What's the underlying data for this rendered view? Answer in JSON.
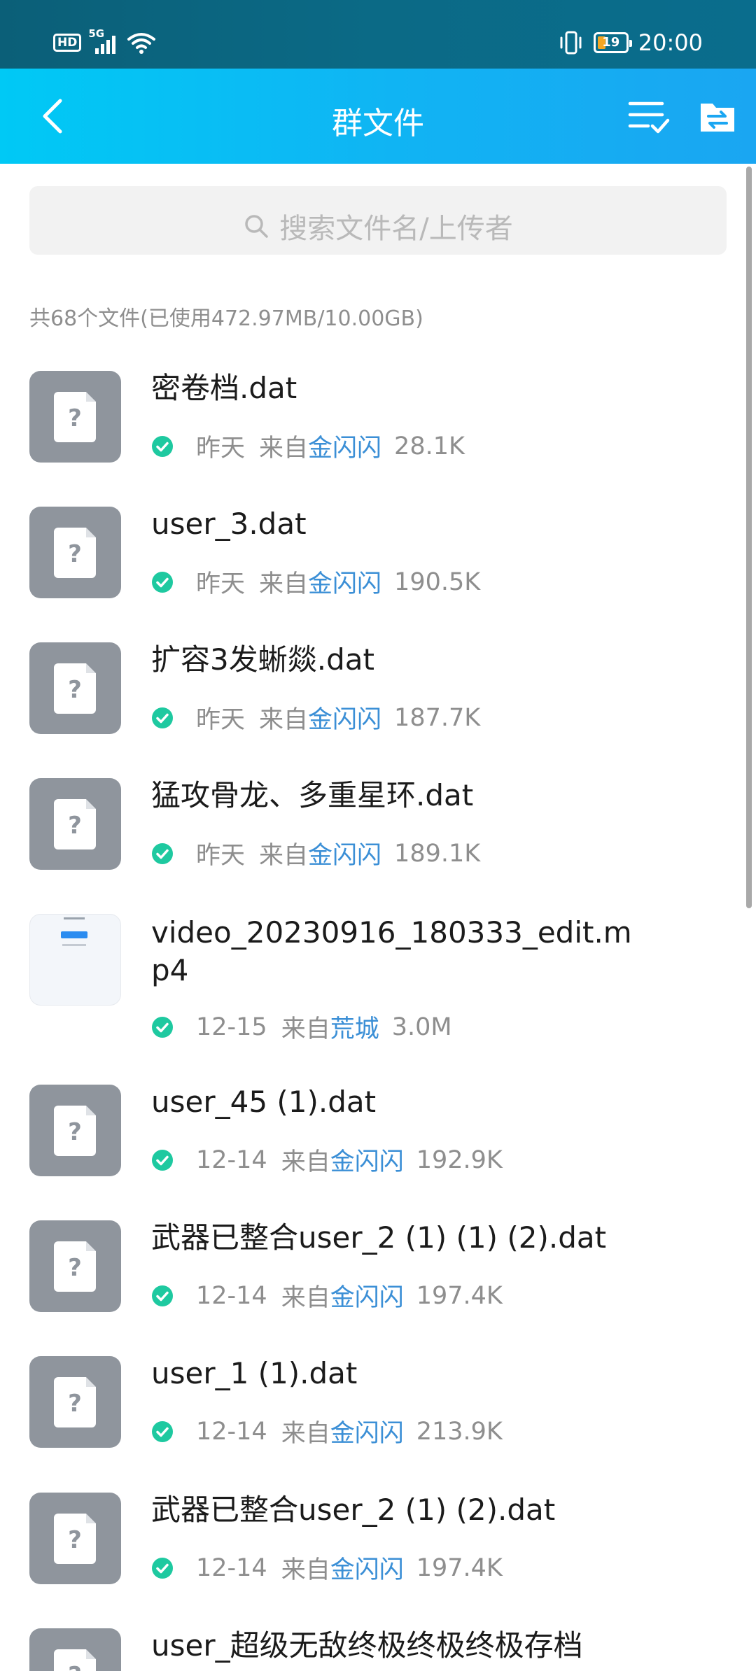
{
  "status_bar": {
    "hd": "HD",
    "network": "5G",
    "battery": "19",
    "time": "20:00"
  },
  "app_bar": {
    "title": "群文件"
  },
  "search": {
    "placeholder": "搜索文件名/上传者"
  },
  "summary": "共68个文件(已使用472.97MB/10.00GB)",
  "from_label": "来自",
  "files": [
    {
      "name": "密卷档.dat",
      "date": "昨天",
      "uploader": "金闪闪",
      "size": "28.1K",
      "type": "unknown"
    },
    {
      "name": "user_3.dat",
      "date": "昨天",
      "uploader": "金闪闪",
      "size": "190.5K",
      "type": "unknown"
    },
    {
      "name": "扩容3发蜥燚.dat",
      "date": "昨天",
      "uploader": "金闪闪",
      "size": "187.7K",
      "type": "unknown"
    },
    {
      "name": "猛攻骨龙、多重星环.dat",
      "date": "昨天",
      "uploader": "金闪闪",
      "size": "189.1K",
      "type": "unknown"
    },
    {
      "name": "video_20230916_180333_edit.mp4",
      "date": "12-15",
      "uploader": "荒城",
      "size": "3.0M",
      "type": "video"
    },
    {
      "name": "user_45 (1).dat",
      "date": "12-14",
      "uploader": "金闪闪",
      "size": "192.9K",
      "type": "unknown"
    },
    {
      "name": "武器已整合user_2 (1) (1) (2).dat",
      "date": "12-14",
      "uploader": "金闪闪",
      "size": "197.4K",
      "type": "unknown"
    },
    {
      "name": "user_1 (1).dat",
      "date": "12-14",
      "uploader": "金闪闪",
      "size": "213.9K",
      "type": "unknown"
    },
    {
      "name": "武器已整合user_2 (1) (2).dat",
      "date": "12-14",
      "uploader": "金闪闪",
      "size": "197.4K",
      "type": "unknown"
    },
    {
      "name": "user_超级无敌终极终极终极存档",
      "date": "",
      "uploader": "",
      "size": "",
      "type": "unknown"
    }
  ],
  "colors": {
    "accent": "#11b3f3",
    "uploader_link": "#3b8fd6",
    "check": "#1ec9a0"
  },
  "icons": [
    "back-icon",
    "sort-check-icon",
    "folder-transfer-icon",
    "search-icon",
    "check-circle-icon",
    "unknown-file-icon"
  ]
}
